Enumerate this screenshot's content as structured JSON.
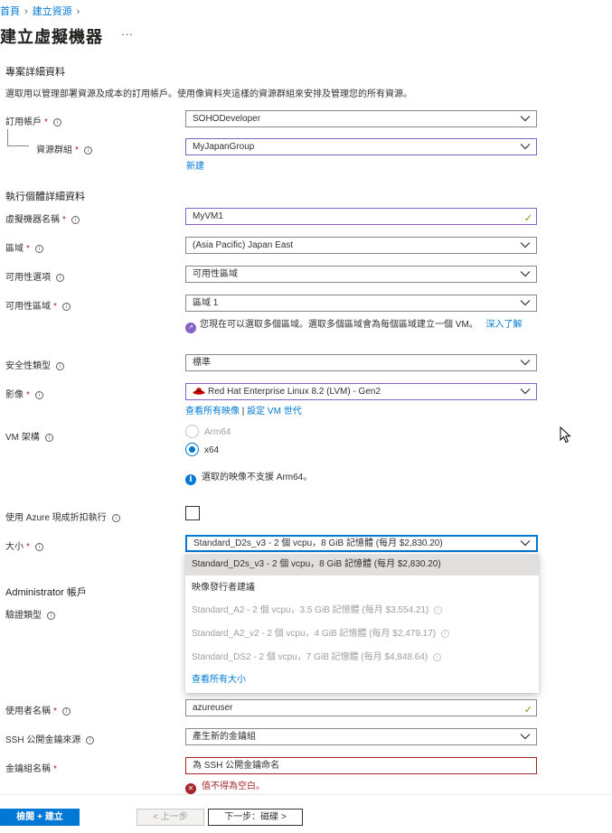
{
  "breadcrumb": {
    "home": "首頁",
    "create": "建立資源",
    "sep": "›"
  },
  "page": {
    "title": "建立虛擬機器",
    "more": "···"
  },
  "project": {
    "section": "專案詳細資料",
    "desc": "選取用以管理部署資源及成本的訂用帳戶。使用像資料夾這樣的資源群組來安排及管理您的所有資源。",
    "subscription_label": "訂用帳戶",
    "subscription_value": "SOHODeveloper",
    "rg_label": "資源群組",
    "rg_value": "MyJapanGroup",
    "rg_new_link": "新建"
  },
  "instance": {
    "section": "執行個體詳細資料",
    "vmname_label": "虛擬機器名稱",
    "vmname_value": "MyVM1",
    "region_label": "區域",
    "region_value": "(Asia Pacific) Japan East",
    "avail_opt_label": "可用性選項",
    "avail_opt_value": "可用性區域",
    "avail_zone_label": "可用性區域",
    "avail_zone_value": "區域 1",
    "zone_note": "您現在可以選取多個區域。選取多個區域會為每個區域建立一個 VM。",
    "zone_link": "深入了解",
    "security_label": "安全性類型",
    "security_value": "標準",
    "image_label": "影像",
    "image_value": "Red Hat Enterprise Linux 8.2 (LVM) - Gen2",
    "image_link_all": "查看所有映像",
    "image_link_sep": " | ",
    "image_link_gen": "設定 VM 世代",
    "arch_label": "VM 架構",
    "arch_arm": "Arm64",
    "arch_x64": "x64",
    "arch_note": "選取的映像不支援 Arm64。",
    "spot_label": "使用 Azure 現成折扣執行",
    "size_label": "大小",
    "size_value": "Standard_D2s_v3 - 2 個 vcpu，8 GiB 記憶體 (每月 $2,830.20)"
  },
  "size_dropdown": {
    "selected": "Standard_D2s_v3 - 2 個 vcpu，8 GiB 記憶體 (每月 $2,830.20)",
    "group_header": "映像發行者建議",
    "options": [
      "Standard_A2 - 2 個 vcpu，3.5 GiB 記憶體 (每月 $3,554.21)",
      "Standard_A2_v2 - 2 個 vcpu，4 GiB 記憶體 (每月 $2,479.17)",
      "Standard_DS2 - 2 個 vcpu，7 GiB 記憶體 (每月 $4,848.64)"
    ],
    "see_all": "查看所有大小"
  },
  "admin": {
    "section": "Administrator 帳戶",
    "auth_label": "驗證類型",
    "username_label": "使用者名稱",
    "username_value": "azureuser",
    "ssh_source_label": "SSH 公開金鑰來源",
    "ssh_source_value": "產生新的金鑰組",
    "keyname_label": "金鑰組名稱",
    "keyname_placeholder": "為 SSH 公開金鑰命名",
    "keyname_error": "值不得為空白。"
  },
  "footer": {
    "review_button": "檢閱 + 建立",
    "prev_button": "< 上一步",
    "next_button": "下一步：磁碟 >"
  },
  "colors": {
    "accent": "#0078d4",
    "purple_border": "#8661c5",
    "error": "#a4262c",
    "success": "#57a300"
  }
}
